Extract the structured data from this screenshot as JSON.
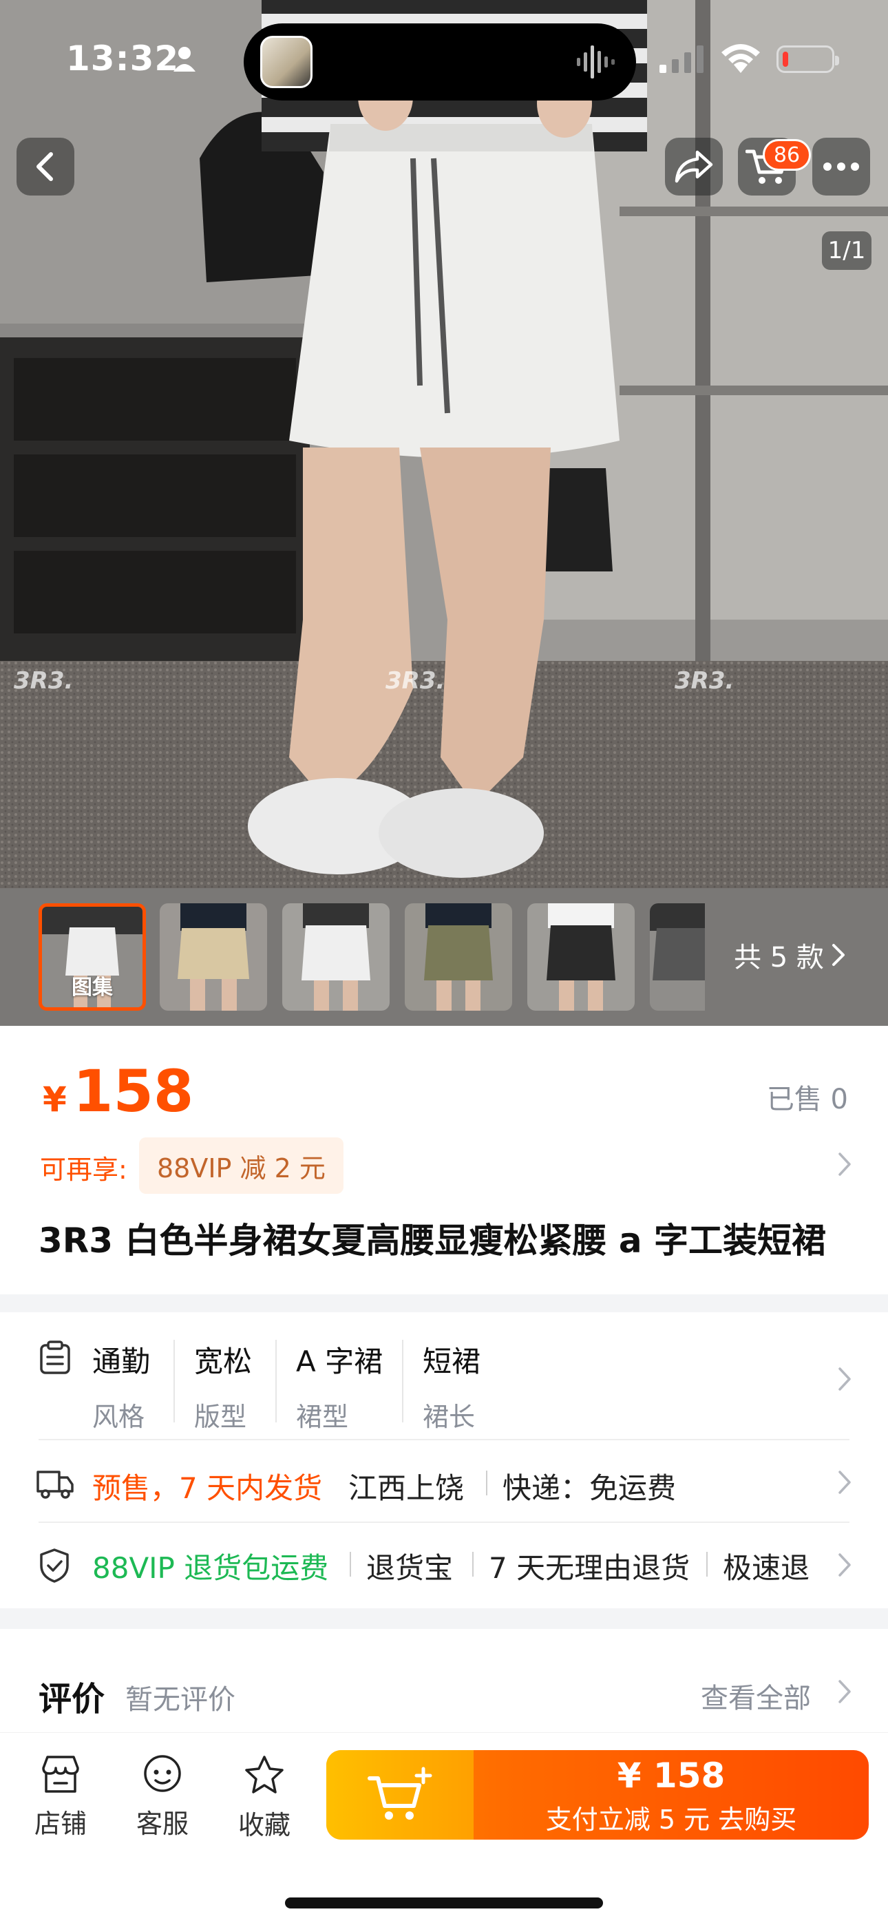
{
  "status_bar": {
    "time": "13:32"
  },
  "nav": {
    "cart_badge": "86",
    "image_counter": "1/1"
  },
  "thumbnails": {
    "first_label": "图集",
    "count_label": "共 5 款"
  },
  "product": {
    "currency": "¥",
    "price": "158",
    "sold": "已售 0",
    "vip_label": "可再享:",
    "vip_chip": "88VIP 减 2 元",
    "title": "3R3 白色半身裙女夏高腰显瘦松紧腰 a 字工装短裙"
  },
  "attributes": [
    {
      "value": "通勤",
      "key": "风格"
    },
    {
      "value": "宽松",
      "key": "版型"
    },
    {
      "value": "A 字裙",
      "key": "裙型"
    },
    {
      "value": "短裙",
      "key": "裙长"
    }
  ],
  "shipping": {
    "presale": "预售，7 天内发货",
    "location": "江西上饶",
    "express": "快递：免运费"
  },
  "guarantee": {
    "vip": "88VIP 退货包运费",
    "items": [
      "退货宝",
      "7 天无理由退货",
      "极速退"
    ]
  },
  "review": {
    "title": "评价",
    "status": "暂无评价",
    "view_all": "查看全部"
  },
  "bottom_nav": {
    "store": "店铺",
    "service": "客服",
    "favorite": "收藏"
  },
  "buy": {
    "price": "¥ 158",
    "subtitle": "支付立减 5 元  去购买"
  },
  "colors": {
    "accent": "#ff5000",
    "vip_green": "#1db954",
    "chip_bg": "#fff2e8"
  }
}
